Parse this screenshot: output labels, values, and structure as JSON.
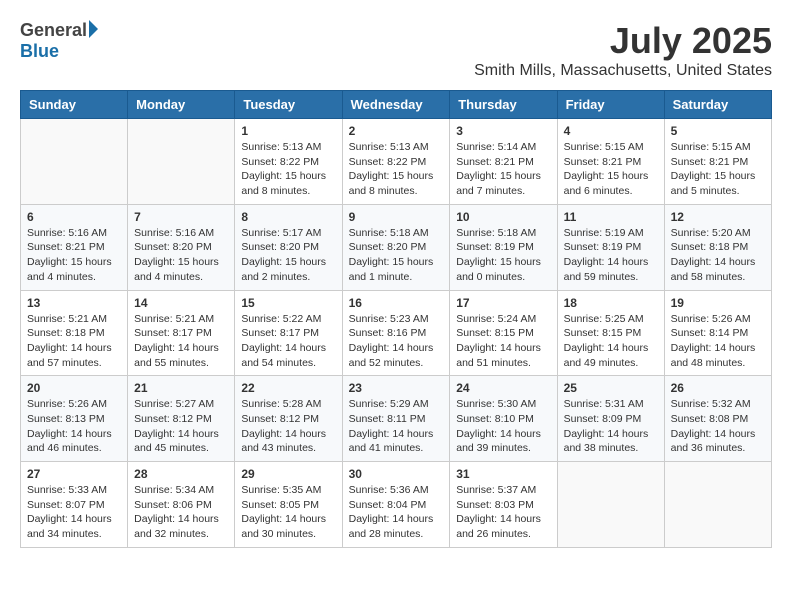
{
  "header": {
    "logo_general": "General",
    "logo_blue": "Blue",
    "month": "July 2025",
    "location": "Smith Mills, Massachusetts, United States"
  },
  "days_of_week": [
    "Sunday",
    "Monday",
    "Tuesday",
    "Wednesday",
    "Thursday",
    "Friday",
    "Saturday"
  ],
  "weeks": [
    [
      {
        "day": "",
        "info": ""
      },
      {
        "day": "",
        "info": ""
      },
      {
        "day": "1",
        "info": "Sunrise: 5:13 AM\nSunset: 8:22 PM\nDaylight: 15 hours and 8 minutes."
      },
      {
        "day": "2",
        "info": "Sunrise: 5:13 AM\nSunset: 8:22 PM\nDaylight: 15 hours and 8 minutes."
      },
      {
        "day": "3",
        "info": "Sunrise: 5:14 AM\nSunset: 8:21 PM\nDaylight: 15 hours and 7 minutes."
      },
      {
        "day": "4",
        "info": "Sunrise: 5:15 AM\nSunset: 8:21 PM\nDaylight: 15 hours and 6 minutes."
      },
      {
        "day": "5",
        "info": "Sunrise: 5:15 AM\nSunset: 8:21 PM\nDaylight: 15 hours and 5 minutes."
      }
    ],
    [
      {
        "day": "6",
        "info": "Sunrise: 5:16 AM\nSunset: 8:21 PM\nDaylight: 15 hours and 4 minutes."
      },
      {
        "day": "7",
        "info": "Sunrise: 5:16 AM\nSunset: 8:20 PM\nDaylight: 15 hours and 4 minutes."
      },
      {
        "day": "8",
        "info": "Sunrise: 5:17 AM\nSunset: 8:20 PM\nDaylight: 15 hours and 2 minutes."
      },
      {
        "day": "9",
        "info": "Sunrise: 5:18 AM\nSunset: 8:20 PM\nDaylight: 15 hours and 1 minute."
      },
      {
        "day": "10",
        "info": "Sunrise: 5:18 AM\nSunset: 8:19 PM\nDaylight: 15 hours and 0 minutes."
      },
      {
        "day": "11",
        "info": "Sunrise: 5:19 AM\nSunset: 8:19 PM\nDaylight: 14 hours and 59 minutes."
      },
      {
        "day": "12",
        "info": "Sunrise: 5:20 AM\nSunset: 8:18 PM\nDaylight: 14 hours and 58 minutes."
      }
    ],
    [
      {
        "day": "13",
        "info": "Sunrise: 5:21 AM\nSunset: 8:18 PM\nDaylight: 14 hours and 57 minutes."
      },
      {
        "day": "14",
        "info": "Sunrise: 5:21 AM\nSunset: 8:17 PM\nDaylight: 14 hours and 55 minutes."
      },
      {
        "day": "15",
        "info": "Sunrise: 5:22 AM\nSunset: 8:17 PM\nDaylight: 14 hours and 54 minutes."
      },
      {
        "day": "16",
        "info": "Sunrise: 5:23 AM\nSunset: 8:16 PM\nDaylight: 14 hours and 52 minutes."
      },
      {
        "day": "17",
        "info": "Sunrise: 5:24 AM\nSunset: 8:15 PM\nDaylight: 14 hours and 51 minutes."
      },
      {
        "day": "18",
        "info": "Sunrise: 5:25 AM\nSunset: 8:15 PM\nDaylight: 14 hours and 49 minutes."
      },
      {
        "day": "19",
        "info": "Sunrise: 5:26 AM\nSunset: 8:14 PM\nDaylight: 14 hours and 48 minutes."
      }
    ],
    [
      {
        "day": "20",
        "info": "Sunrise: 5:26 AM\nSunset: 8:13 PM\nDaylight: 14 hours and 46 minutes."
      },
      {
        "day": "21",
        "info": "Sunrise: 5:27 AM\nSunset: 8:12 PM\nDaylight: 14 hours and 45 minutes."
      },
      {
        "day": "22",
        "info": "Sunrise: 5:28 AM\nSunset: 8:12 PM\nDaylight: 14 hours and 43 minutes."
      },
      {
        "day": "23",
        "info": "Sunrise: 5:29 AM\nSunset: 8:11 PM\nDaylight: 14 hours and 41 minutes."
      },
      {
        "day": "24",
        "info": "Sunrise: 5:30 AM\nSunset: 8:10 PM\nDaylight: 14 hours and 39 minutes."
      },
      {
        "day": "25",
        "info": "Sunrise: 5:31 AM\nSunset: 8:09 PM\nDaylight: 14 hours and 38 minutes."
      },
      {
        "day": "26",
        "info": "Sunrise: 5:32 AM\nSunset: 8:08 PM\nDaylight: 14 hours and 36 minutes."
      }
    ],
    [
      {
        "day": "27",
        "info": "Sunrise: 5:33 AM\nSunset: 8:07 PM\nDaylight: 14 hours and 34 minutes."
      },
      {
        "day": "28",
        "info": "Sunrise: 5:34 AM\nSunset: 8:06 PM\nDaylight: 14 hours and 32 minutes."
      },
      {
        "day": "29",
        "info": "Sunrise: 5:35 AM\nSunset: 8:05 PM\nDaylight: 14 hours and 30 minutes."
      },
      {
        "day": "30",
        "info": "Sunrise: 5:36 AM\nSunset: 8:04 PM\nDaylight: 14 hours and 28 minutes."
      },
      {
        "day": "31",
        "info": "Sunrise: 5:37 AM\nSunset: 8:03 PM\nDaylight: 14 hours and 26 minutes."
      },
      {
        "day": "",
        "info": ""
      },
      {
        "day": "",
        "info": ""
      }
    ]
  ]
}
